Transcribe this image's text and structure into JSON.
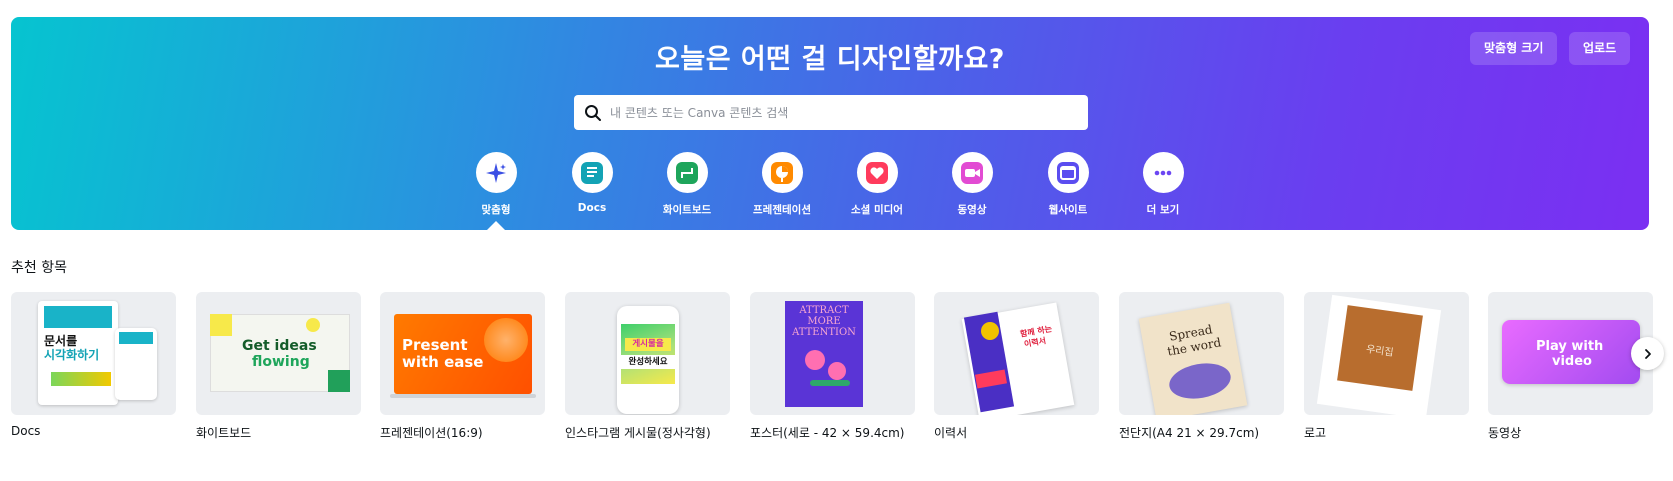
{
  "hero": {
    "title": "오늘은 어떤 걸 디자인할까요?",
    "custom_size_label": "맞춤형 크기",
    "upload_label": "업로드",
    "search": {
      "placeholder": "내 콘텐츠 또는 Canva 콘텐츠 검색",
      "value": ""
    },
    "categories": [
      {
        "label": "맞춤형",
        "icon": "sparkle-icon",
        "color": "#3b4fe4",
        "selected": true
      },
      {
        "label": "Docs",
        "icon": "doc-icon",
        "color": "#13a3b5"
      },
      {
        "label": "화이트보드",
        "icon": "whiteboard-icon",
        "color": "#1ea55b"
      },
      {
        "label": "프레젠테이션",
        "icon": "presentation-icon",
        "color": "#ff8a00"
      },
      {
        "label": "소셜 미디어",
        "icon": "heart-icon",
        "color": "#ff3b5c"
      },
      {
        "label": "동영상",
        "icon": "video-icon",
        "color": "#e24bd3"
      },
      {
        "label": "웹사이트",
        "icon": "website-icon",
        "color": "#5b4df0"
      },
      {
        "label": "더 보기",
        "icon": "more-icon",
        "color": "#6b46f2"
      }
    ]
  },
  "featured": {
    "title": "추천 항목",
    "items": [
      {
        "label": "Docs",
        "thumb_text_1": "문서를",
        "thumb_text_2": "시각화하기"
      },
      {
        "label": "화이트보드",
        "thumb_text_1": "Get ideas",
        "thumb_text_2": "flowing"
      },
      {
        "label": "프레젠테이션(16:9)",
        "thumb_text_1": "Present",
        "thumb_text_2": "with ease"
      },
      {
        "label": "인스타그램 게시물(정사각형)",
        "thumb_text_1": "게시물을",
        "thumb_text_2": "완성하세요"
      },
      {
        "label": "포스터(세로 - 42 × 59.4cm)",
        "thumb_text_1": "ATTRACT",
        "thumb_text_2": "MORE",
        "thumb_text_3": "ATTENTION"
      },
      {
        "label": "이력서",
        "thumb_text_1": "함께 하는",
        "thumb_text_2": "이력서"
      },
      {
        "label": "전단지(A4 21 × 29.7cm)",
        "thumb_text_1": "Spread",
        "thumb_text_2": "the word"
      },
      {
        "label": "로고",
        "thumb_text_1": "우리집"
      },
      {
        "label": "동영상",
        "thumb_text_1": "Play with",
        "thumb_text_2": "video"
      }
    ]
  },
  "next_icon": "chevron-right-icon"
}
